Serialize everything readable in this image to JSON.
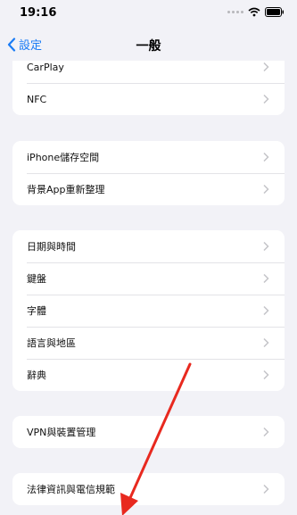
{
  "status_bar": {
    "time": "19:16"
  },
  "nav": {
    "back_label": "設定",
    "title": "一般"
  },
  "groups": [
    {
      "items": [
        {
          "label": "CarPlay"
        },
        {
          "label": "NFC"
        }
      ]
    },
    {
      "items": [
        {
          "label": "iPhone儲存空間"
        },
        {
          "label": "背景App重新整理"
        }
      ]
    },
    {
      "items": [
        {
          "label": "日期與時間"
        },
        {
          "label": "鍵盤"
        },
        {
          "label": "字體"
        },
        {
          "label": "語言與地區"
        },
        {
          "label": "辭典"
        }
      ]
    },
    {
      "items": [
        {
          "label": "VPN與裝置管理"
        }
      ]
    },
    {
      "items": [
        {
          "label": "法律資訊與電信規範"
        }
      ]
    }
  ],
  "colors": {
    "accent": "#1a7cf5",
    "background": "#f2f2f7",
    "annotation_arrow": "#e8291f"
  },
  "icons": {
    "back": "chevron-left-icon",
    "row": "chevron-right-icon",
    "wifi": "wifi-icon",
    "battery": "battery-icon"
  }
}
